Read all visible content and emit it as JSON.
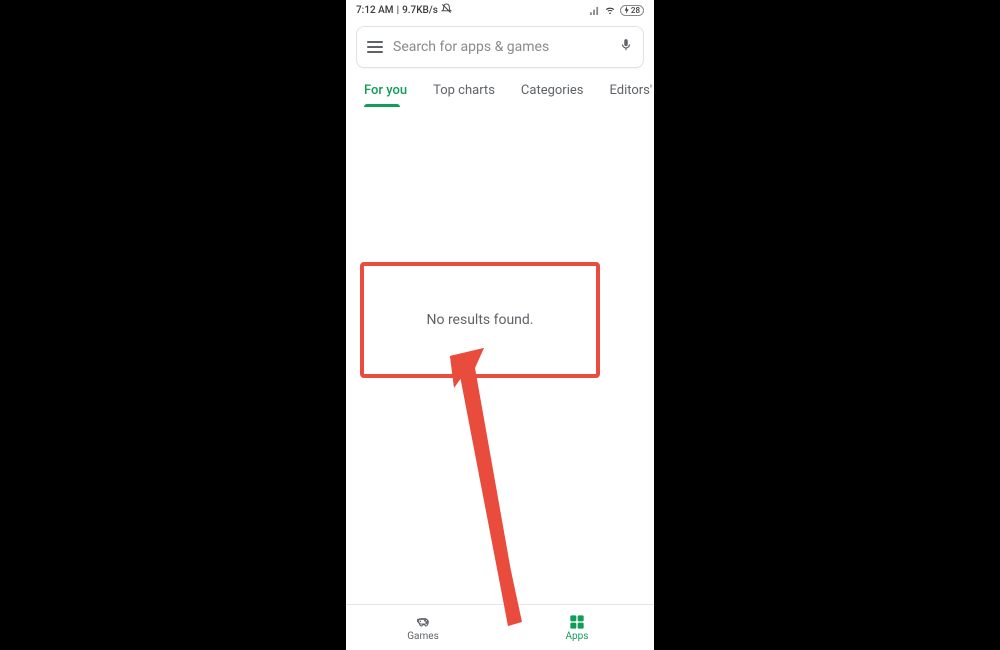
{
  "status": {
    "time": "7:12 AM",
    "net_speed": "9.7KB/s",
    "battery": "28"
  },
  "search": {
    "placeholder": "Search for apps & games"
  },
  "tabs": {
    "for_you": "For you",
    "top_charts": "Top charts",
    "categories": "Categories",
    "editors": "Editors'"
  },
  "content": {
    "no_results": "No results found."
  },
  "bottom_nav": {
    "games": "Games",
    "apps": "Apps"
  },
  "colors": {
    "accent": "#0f9d58",
    "highlight": "#e94b3c"
  }
}
